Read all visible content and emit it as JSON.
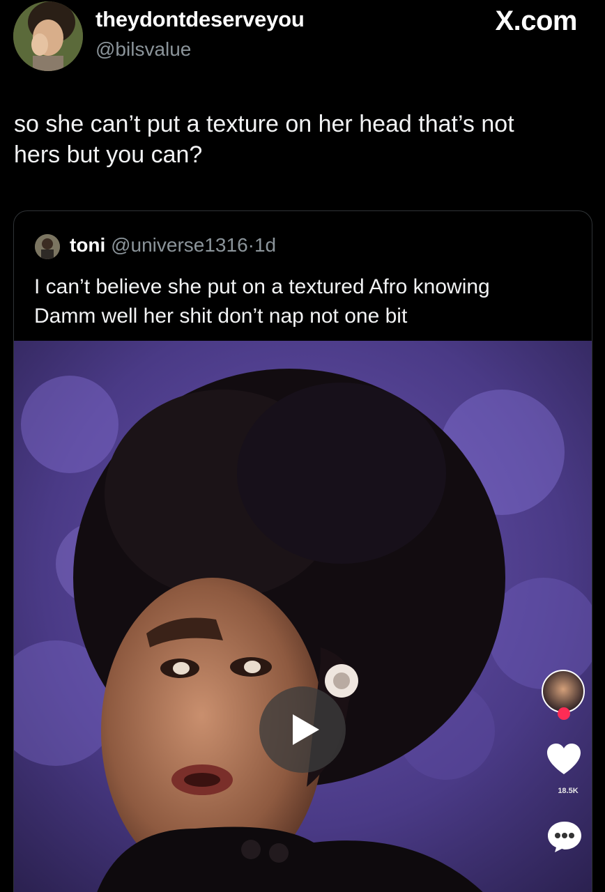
{
  "author": {
    "display_name": "theydontdeserveyou",
    "handle": "@bilsvalue"
  },
  "brand": "X.com",
  "tweet": {
    "line1": "so she can’t put a texture on her head that’s not",
    "line2": "hers but you can?"
  },
  "quote": {
    "display_name": "toni",
    "handle": "@universe1316",
    "separator": "·",
    "time": "1d",
    "line1": "I can’t believe she put on a textured Afro knowing",
    "line2": "Damm well her shit don’t nap not one bit"
  },
  "media": {
    "type": "video",
    "like_count": "18.5K"
  },
  "icons": [
    "author-avatar",
    "quote-avatar",
    "play-icon",
    "heart-icon",
    "comment-icon"
  ],
  "colors": {
    "background": "#000000",
    "text_primary": "#e7e9ea",
    "text_secondary": "#8b949a",
    "border": "#2f3336",
    "tiktok_accent": "#fe2c55"
  }
}
